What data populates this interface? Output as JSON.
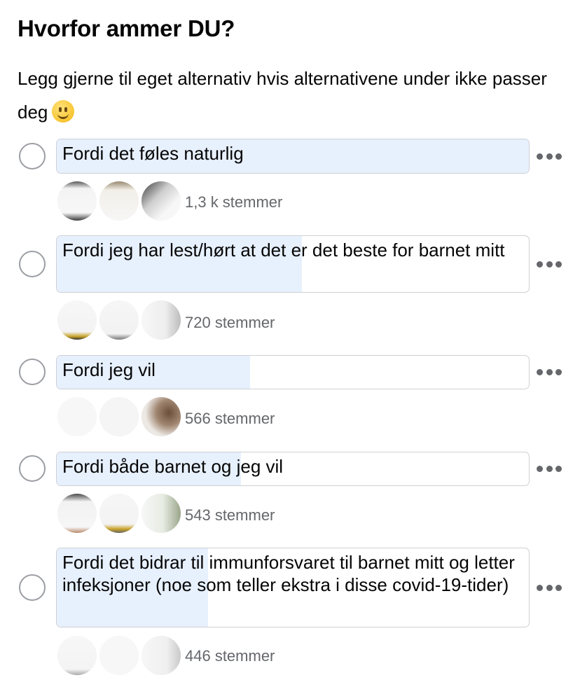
{
  "post": {
    "title": "Hvorfor ammer DU?",
    "subtitle": "Legg gjerne til eget alternativ hvis alternativene under ikke passer deg",
    "subtitle_emoji": "slightly-smiling-face-emoji"
  },
  "options": [
    {
      "label": "Fordi det føles naturlig",
      "votes": "1,3 k stemmer",
      "vote_share": 1.0
    },
    {
      "label": "Fordi jeg har lest/hørt at det er det beste for barnet mitt",
      "votes": "720 stemmer",
      "vote_share": 0.52
    },
    {
      "label": "Fordi jeg vil",
      "votes": "566 stemmer",
      "vote_share": 0.41
    },
    {
      "label": "Fordi både barnet og jeg vil",
      "votes": "543 stemmer",
      "vote_share": 0.39
    },
    {
      "label": "Fordi det bidrar til immunforsvaret til barnet mitt og letter infeksjoner (noe som teller ekstra i disse covid-19-tider)",
      "votes": "446 stemmer",
      "vote_share": 0.32
    }
  ],
  "icons": {
    "more": "more-options-icon",
    "radio": "radio-button"
  },
  "colors": {
    "fill": "#e7f0fd",
    "border": "#ced0d4",
    "muted_text": "#65676b"
  }
}
